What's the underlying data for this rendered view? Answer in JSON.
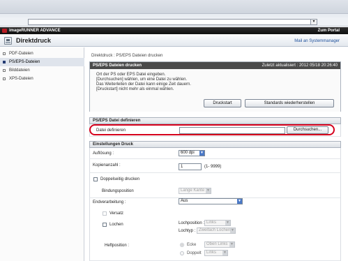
{
  "header": {
    "brand": "imageRUNNER ADVANCE",
    "portal_link": "Zum Portal",
    "title": "Direktdruck",
    "mail_link": "Mail an Systemmanager"
  },
  "sidebar": {
    "items": [
      {
        "label": "PDF-Dateien"
      },
      {
        "label": "PS/EPS-Dateien"
      },
      {
        "label": "Bilddateien"
      },
      {
        "label": "XPS-Dateien"
      }
    ]
  },
  "breadcrumb": "Direktdruck : PS/EPS Dateien drucken",
  "print_panel": {
    "title": "PS/EPS Dateien drucken",
    "updated": "Zuletzt aktualisiert : 2012 05/18 20:26:40",
    "instructions": [
      "Ort der PS oder EPS Datei eingeben.",
      "[Durchsuchen] wählen, um eine Datei zu wählen.",
      "Das Weiterleiten der Datei kann einige Zeit dauern.",
      "[Druckstart] nicht mehr als einmal wählen."
    ],
    "start_button": "Druckstart",
    "reset_button": "Standards wiederherstellen"
  },
  "file_section": {
    "title": "PS/EPS Datei definieren",
    "label": "Datei definieren",
    "value": "",
    "browse_button": "Durchsuchen..."
  },
  "settings": {
    "title": "Einstellungen Druck",
    "resolution_label": "Auflösung :",
    "resolution_value": "600 dpi",
    "copies_label": "Kopienanzahl :",
    "copies_value": "1",
    "copies_range": "(1- 9999)",
    "duplex_label": "Doppelseitig drucken",
    "binding_label": "Bindungsposition",
    "binding_value": "Lange Kante",
    "finishing_label": "Endverarbeitung :",
    "finishing_value": "Aus",
    "offset_label": "Versatz",
    "punch_label": "Lochen",
    "hole_position_label": "Lochposition :",
    "hole_position_value": "Links",
    "hole_type_label": "Lochtyp :",
    "hole_type_value": "Zweifach Lochen",
    "staple_label": "Heftposition :",
    "corner_label": "Ecke",
    "corner_value": "Oben Links",
    "double_label": "Doppelt",
    "double_value": "Links"
  }
}
